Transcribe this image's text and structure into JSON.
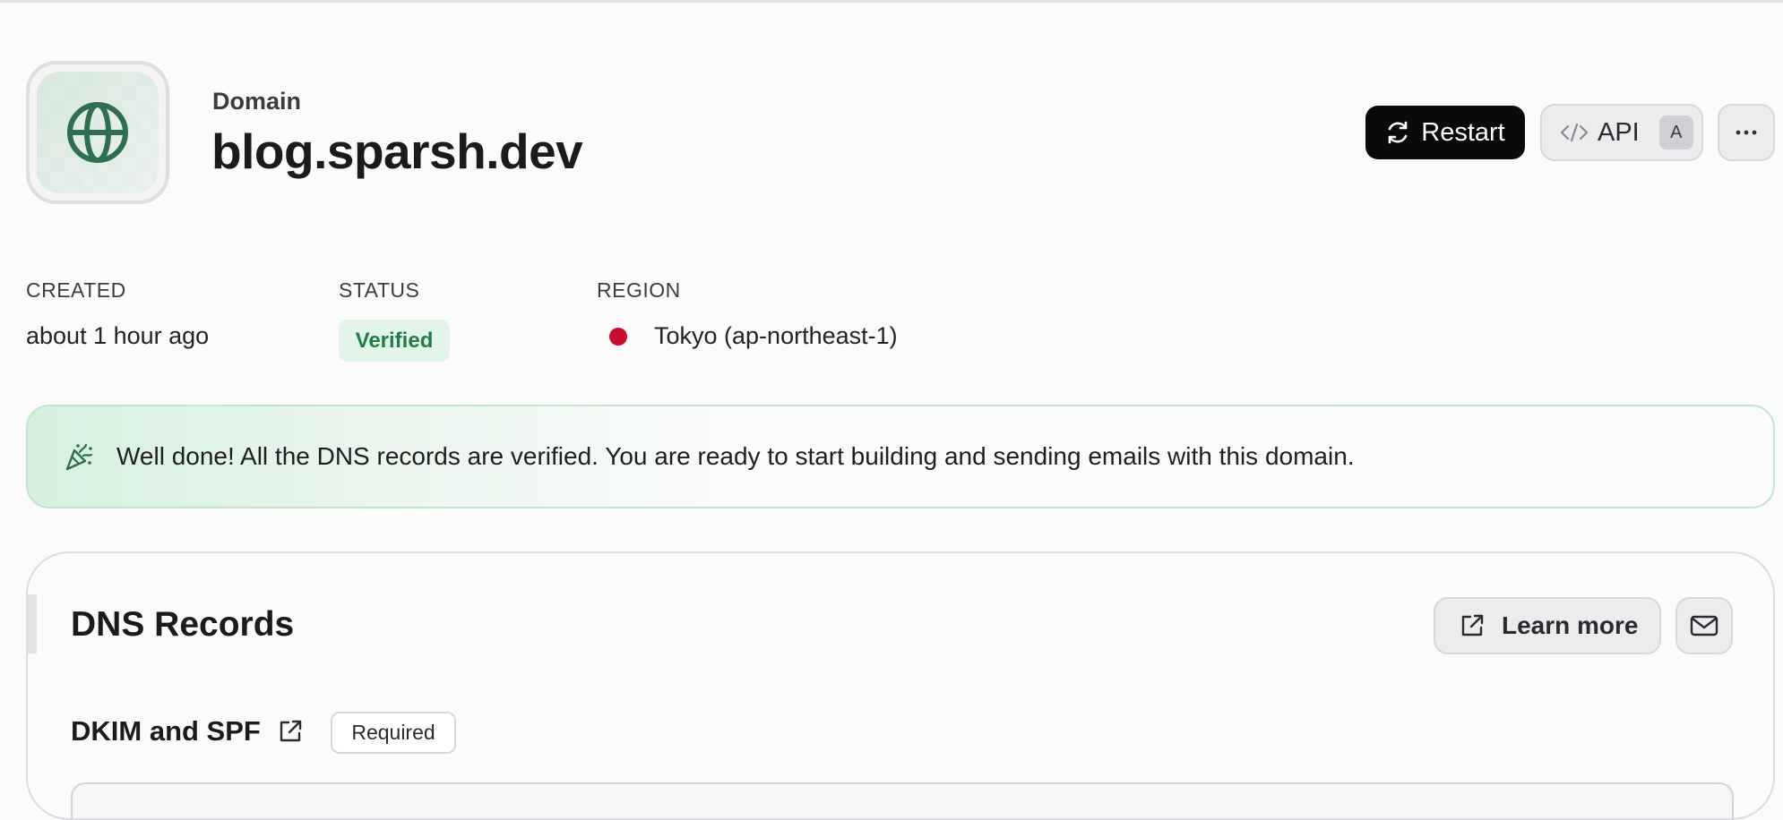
{
  "header": {
    "eyebrow": "Domain",
    "title": "blog.sparsh.dev",
    "icon": "globe-icon"
  },
  "actions": {
    "restart_label": "Restart",
    "restart_icon": "refresh-icon",
    "api_label": "API",
    "api_icon": "code-icon",
    "api_shortcut": "A",
    "more_icon": "ellipsis-icon"
  },
  "meta": {
    "created_label": "CREATED",
    "created_value": "about 1 hour ago",
    "status_label": "STATUS",
    "status_value": "Verified",
    "region_label": "REGION",
    "region_value": "Tokyo (ap-northeast-1)",
    "region_flag": "japan-flag"
  },
  "banner": {
    "icon": "party-popper-icon",
    "message": "Well done! All the DNS records are verified. You are ready to start building and sending emails with this domain."
  },
  "dns": {
    "title": "DNS Records",
    "learn_more_label": "Learn more",
    "learn_more_icon": "external-link-icon",
    "mail_icon": "mail-icon",
    "section_title": "DKIM and SPF",
    "section_badge": "Required"
  },
  "colors": {
    "accent_green": "#2f6e4f",
    "success_badge_text": "#1f7d45",
    "success_badge_bg": "#e3f4e8",
    "primary_button": "#0a0a0a",
    "flag_red": "#c8102e"
  }
}
